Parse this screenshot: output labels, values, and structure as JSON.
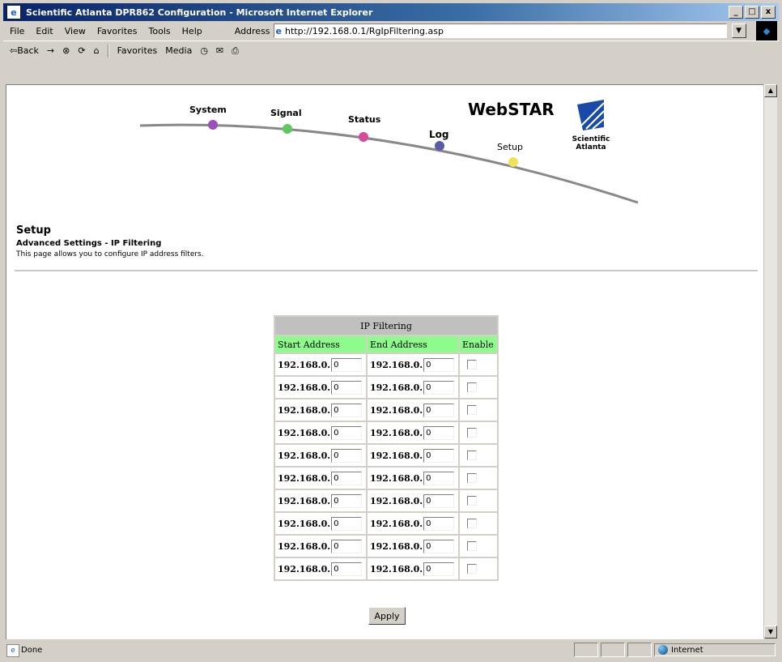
{
  "window": {
    "title": "Scientific Atlanta DPR862 Configuration - Microsoft Internet Explorer",
    "buttons": [
      "_",
      "□",
      "x"
    ]
  },
  "menu": [
    "File",
    "Edit",
    "View",
    "Favorites",
    "Tools",
    "Help"
  ],
  "address": {
    "label": "Address",
    "url": "http://192.168.0.1/RgIpFiltering.asp"
  },
  "toolbar": [
    "⇦Back",
    "→",
    "Favorites",
    "Media"
  ],
  "header_nav": {
    "system": "System",
    "signal": "Signal",
    "status": "Status",
    "log": "Log",
    "setup": "Setup",
    "brand": "WebSTAR",
    "company": "Scientific Atlanta"
  },
  "page": {
    "title": "Setup",
    "subtitle": "Advanced Settings - IP Filtering",
    "description": "This page allows you to configure IP address filters."
  },
  "filter": {
    "caption": "IP Filtering",
    "headers": [
      "Start Address",
      "End Address",
      "Enable"
    ],
    "prefix": "192.168.0.",
    "rows": [
      {
        "start": "0",
        "end": "0",
        "enabled": false
      },
      {
        "start": "0",
        "end": "0",
        "enabled": false
      },
      {
        "start": "0",
        "end": "0",
        "enabled": false
      },
      {
        "start": "0",
        "end": "0",
        "enabled": false
      },
      {
        "start": "0",
        "end": "0",
        "enabled": false
      },
      {
        "start": "0",
        "end": "0",
        "enabled": false
      },
      {
        "start": "0",
        "end": "0",
        "enabled": false
      },
      {
        "start": "0",
        "end": "0",
        "enabled": false
      },
      {
        "start": "0",
        "end": "0",
        "enabled": false
      },
      {
        "start": "0",
        "end": "0",
        "enabled": false
      }
    ],
    "apply_label": "Apply"
  },
  "statusbar": {
    "left": "Done",
    "zone": "Internet"
  },
  "colors": {
    "header_green": "#8dfc8d",
    "system_dot": "#9b4fb8",
    "signal_dot": "#5dc85d",
    "status_dot": "#d84a98",
    "log_dot": "#5a5aa8",
    "setup_dot": "#f2e25a"
  }
}
